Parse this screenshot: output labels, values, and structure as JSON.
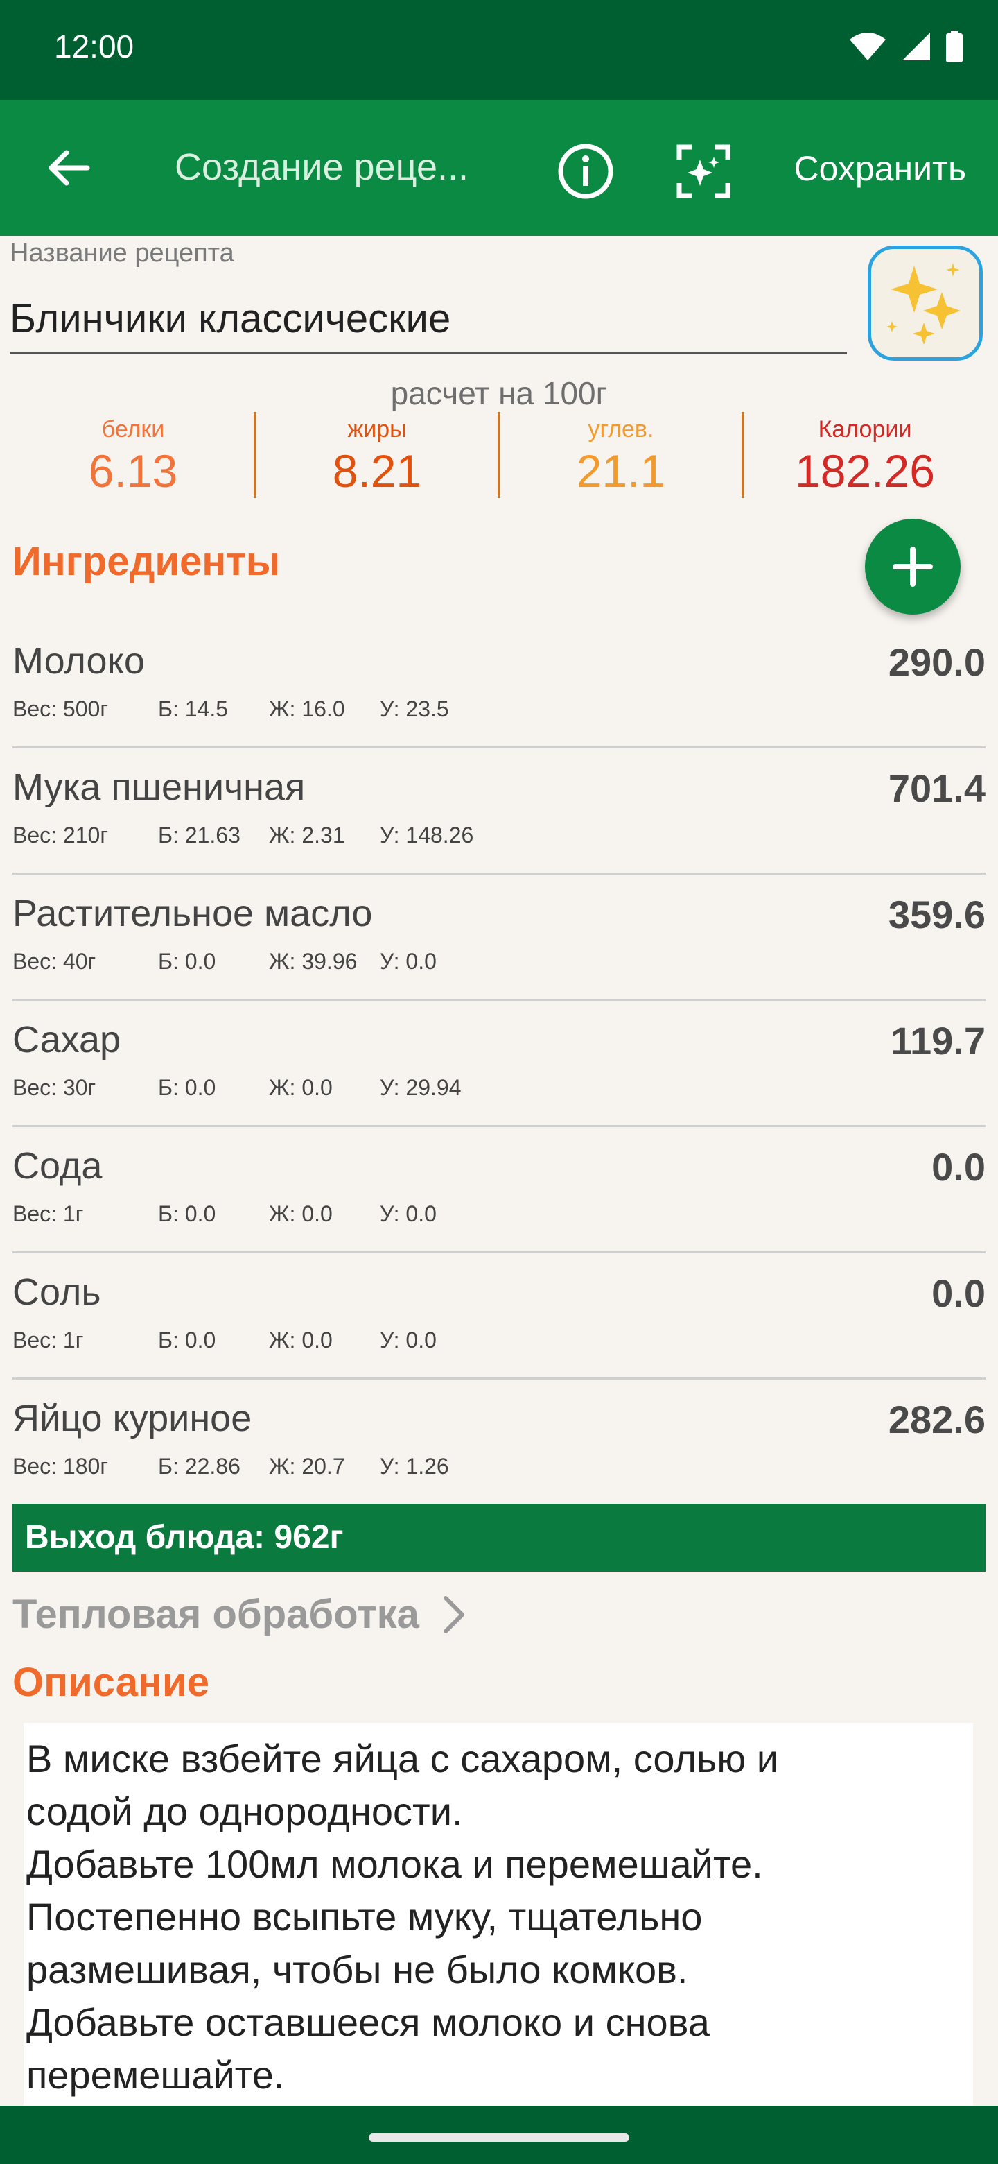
{
  "status_bar": {
    "time": "12:00"
  },
  "app_bar": {
    "title": "Создание реце...",
    "save_label": "Сохранить"
  },
  "recipe": {
    "name_label": "Название рецепта",
    "name_value": "Блинчики классические"
  },
  "nutrition": {
    "per_label": "расчет на 100г",
    "items": [
      {
        "label": "белки",
        "value": "6.13",
        "color": "#f3743a"
      },
      {
        "label": "жиры",
        "value": "8.21",
        "color": "#e2520f"
      },
      {
        "label": "углев.",
        "value": "21.1",
        "color": "#f39a2c"
      },
      {
        "label": "Калории",
        "value": "182.26",
        "color": "#d42a26"
      }
    ]
  },
  "ingredients": {
    "title": "Ингредиенты",
    "items": [
      {
        "name": "Молоко",
        "kcal": "290.0",
        "weight": "Вес: 500г",
        "b": "Б: 14.5",
        "g": "Ж: 16.0",
        "u": "У: 23.5"
      },
      {
        "name": "Мука пшеничная",
        "kcal": "701.4",
        "weight": "Вес: 210г",
        "b": "Б: 21.63",
        "g": "Ж: 2.31",
        "u": "У: 148.26"
      },
      {
        "name": "Растительное масло",
        "kcal": "359.6",
        "weight": "Вес: 40г",
        "b": "Б: 0.0",
        "g": "Ж: 39.96",
        "u": "У: 0.0"
      },
      {
        "name": "Сахар",
        "kcal": "119.7",
        "weight": "Вес: 30г",
        "b": "Б: 0.0",
        "g": "Ж: 0.0",
        "u": "У: 29.94"
      },
      {
        "name": "Сода",
        "kcal": "0.0",
        "weight": "Вес: 1г",
        "b": "Б: 0.0",
        "g": "Ж: 0.0",
        "u": "У: 0.0"
      },
      {
        "name": "Соль",
        "kcal": "0.0",
        "weight": "Вес: 1г",
        "b": "Б: 0.0",
        "g": "Ж: 0.0",
        "u": "У: 0.0"
      },
      {
        "name": "Яйцо куриное",
        "kcal": "282.6",
        "weight": "Вес: 180г",
        "b": "Б: 22.86",
        "g": "Ж: 20.7",
        "u": "У: 1.26"
      }
    ]
  },
  "yield_label": "Выход блюда: 962г",
  "heat_label": "Тепловая обработка",
  "description": {
    "title": "Описание",
    "text": "В миске взбейте яйца с сахаром, солью и\nсодой до однородности.\nДобавьте 100мл молока и перемешайте.\nПостепенно всыпьте муку, тщательно\nразмешивая, чтобы не было комков.\nДобавьте оставшееся молоко и снова\nперемешайте."
  },
  "colors": {
    "primary": "#0b8a43",
    "status": "#005f30",
    "accent": "#f06a2b",
    "background": "#f7f3ef"
  },
  "icons": [
    "back-arrow-icon",
    "info-icon",
    "ai-scan-icon",
    "sparkles-icon",
    "plus-icon",
    "chevron-right-icon",
    "wifi-icon",
    "signal-icon",
    "battery-icon"
  ]
}
